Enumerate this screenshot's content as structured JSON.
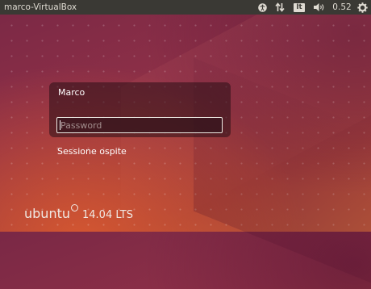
{
  "top_panel": {
    "hostname": "marco-VirtualBox",
    "indicators": {
      "accessibility_icon": "accessibility-icon",
      "network_icon": "network-arrows-icon",
      "keyboard_layout": "It",
      "volume_icon": "speaker-volume-icon",
      "clock": "0.52",
      "session_icon": "gear-icon"
    }
  },
  "login": {
    "user_name": "Marco",
    "password_placeholder": "Password",
    "password_value": "",
    "guest_session": "Sessione ospite"
  },
  "branding": {
    "word": "ubuntu",
    "version": "14.04 LTS"
  },
  "colors": {
    "panel": "#3a3934",
    "background_top": "#7a2846",
    "background_bottom": "#b8573a",
    "text": "#ffffff"
  }
}
